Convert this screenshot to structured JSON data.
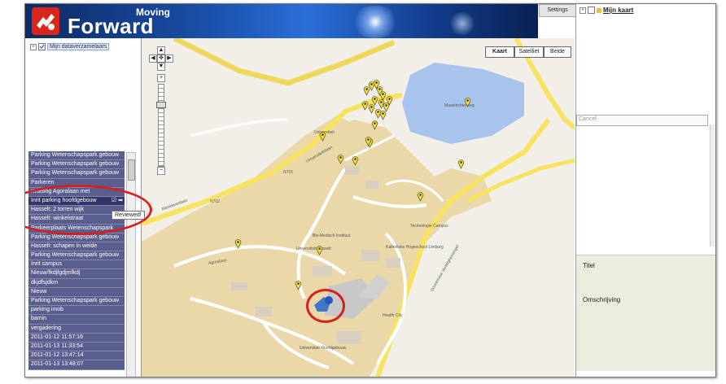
{
  "header": {
    "brand_top": "Moving",
    "brand_main": "Forward"
  },
  "settings_tab": "Settings",
  "left_panel": {
    "tree_label": "Mijn dataverzamelaars",
    "list_items": [
      "Parking Wetenschapspark gebouw",
      "Parking Wetenschapspark gebouw",
      "Parking Wetenschapspark gebouw",
      "Parkeren",
      "Kruising Agoralaan met",
      "Inrit parking hoofdgebouw",
      "Hasselt: 2 torren wijk",
      "Hasselt: winkelstraat",
      "Parkeerplaats Wetenschapspark",
      "Parking Wetenschapspark gebouw",
      "Hasselt: schapen in weide",
      "Parking Wetenschapspark gebouw",
      "Inrit campus",
      "Nieuw/fkdjfgdjmfkdj",
      "dkjdfsjdkm",
      "Nieuw",
      "Parking Wetenschapspark gebouw",
      "parking imob",
      "bamin",
      "vergadering",
      "2011-01-12 11:57:16",
      "2011-01-13 11:33:54",
      "2011-01-12 13:47:14",
      "2011-01-13 13:48:07"
    ],
    "tooltip": "Reviewed!"
  },
  "map": {
    "type_buttons": [
      "Kaart",
      "Satelliet",
      "Beide"
    ],
    "zoom_labels": {
      "in": "+",
      "out": "−",
      "up": "▲",
      "down": "▼",
      "left": "◀",
      "right": "▶",
      "center": "✥"
    },
    "labels": [
      "Universiteit",
      "Universiteit Hasselt",
      "Bio-Medisch Instituut",
      "Technologie Campus",
      "Katholieke Hogeschool Limburg",
      "Maastrichterweg",
      "Health City",
      "Universitair Hoofdgebouw",
      "Agoralaan",
      "Universiteitslaan",
      "Gouverneur Verwilghensingel",
      "Martelarenlaan",
      "N702",
      "N715",
      "Universitair Hoofdgebouw"
    ]
  },
  "right_panel": {
    "tree_label": "Mijn kaart",
    "cancel_placeholder": "Cancel",
    "titel_label": "Titel",
    "omschrijving_label": "Omschrijving"
  },
  "colors": {
    "header_blue": "#1a4fa8",
    "list_bg": "#5a5e8e",
    "highlight_red": "#d62020",
    "map_campus": "#ebd8a8",
    "map_building": "#a8c4ec",
    "road_yellow": "#f7e35f"
  }
}
